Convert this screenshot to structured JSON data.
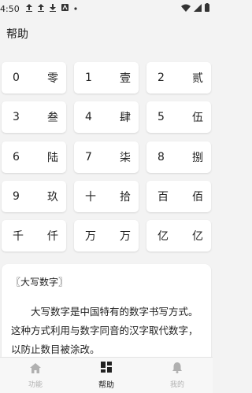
{
  "status_bar": {
    "time": "4:50",
    "icons": [
      "upload-icon",
      "upload-icon",
      "download-icon",
      "notification-a-icon",
      "dot-icon"
    ]
  },
  "app_bar": {
    "title": "帮助"
  },
  "keypad": {
    "rows": [
      [
        {
          "a": "0",
          "b": "零"
        },
        {
          "a": "1",
          "b": "壹"
        },
        {
          "a": "2",
          "b": "贰"
        }
      ],
      [
        {
          "a": "3",
          "b": "叁"
        },
        {
          "a": "4",
          "b": "肆"
        },
        {
          "a": "5",
          "b": "伍"
        }
      ],
      [
        {
          "a": "6",
          "b": "陆"
        },
        {
          "a": "7",
          "b": "柒"
        },
        {
          "a": "8",
          "b": "捌"
        }
      ],
      [
        {
          "a": "9",
          "b": "玖"
        },
        {
          "a": "十",
          "b": "拾"
        },
        {
          "a": "百",
          "b": "佰"
        }
      ],
      [
        {
          "a": "千",
          "b": "仟"
        },
        {
          "a": "万",
          "b": "万"
        },
        {
          "a": "亿",
          "b": "亿"
        }
      ]
    ]
  },
  "info_card": {
    "heading": "〖大写数字〗",
    "body": "大写数字是中国特有的数字书写方式。这种方式利用与数字同音的汉字取代数字，以防止数目被涂改。"
  },
  "bottom_nav": {
    "items": [
      {
        "label": "功能",
        "icon": "home-icon",
        "active": false
      },
      {
        "label": "帮助",
        "icon": "dashboard-icon",
        "active": true
      },
      {
        "label": "我的",
        "icon": "bell-icon",
        "active": false
      }
    ],
    "colors": {
      "active": "#222222",
      "inactive": "#b0b0b0"
    }
  }
}
